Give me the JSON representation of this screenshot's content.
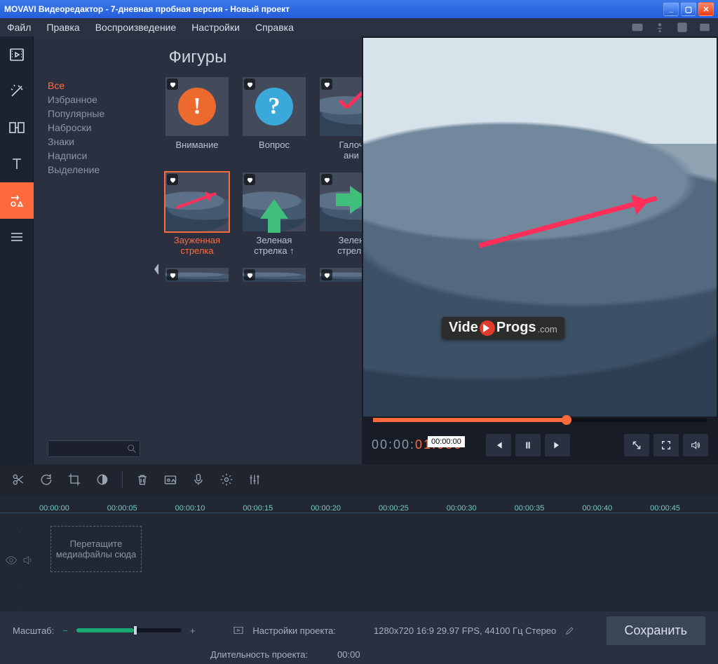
{
  "title": "MOVAVI Видеоредактор - 7-дневная пробная версия - Новый проект",
  "menu": {
    "file": "Файл",
    "edit": "Правка",
    "play": "Воспроизведение",
    "settings": "Настройки",
    "help": "Справка"
  },
  "panel": {
    "title": "Фигуры",
    "filters": [
      "Все",
      "Избранное",
      "Популярные",
      "Наброски",
      "Знаки",
      "Надписи",
      "Выделение"
    ],
    "active_filter": 0,
    "search_placeholder": "",
    "items": [
      {
        "label": "Внимание",
        "kind": "disk-orange-excl",
        "selected": false
      },
      {
        "label": "Вопрос",
        "kind": "disk-blue-q",
        "selected": false
      },
      {
        "label": "Галочка",
        "kind": "check-red",
        "selected": false,
        "clipped": "Галоч\nани"
      },
      {
        "label": "Зауженная стрелка",
        "kind": "arrow-red",
        "selected": true
      },
      {
        "label": "Зеленая стрелка ↑",
        "kind": "arrow-up-green",
        "selected": false
      },
      {
        "label": "Зеленая стрелка →",
        "kind": "arrow-right-green",
        "selected": false,
        "clipped": "Зелен\nстрелк"
      }
    ]
  },
  "player": {
    "timecode_gray": "00:00:",
    "timecode_orange": "01.086",
    "tooltip": "00:00:00",
    "progress_pct": 58
  },
  "timeline": {
    "ruler": [
      "00:00:00",
      "00:00:05",
      "00:00:10",
      "00:00:15",
      "00:00:20",
      "00:00:25",
      "00:00:30",
      "00:00:35",
      "00:00:40",
      "00:00:45"
    ],
    "dropzone": "Перетащите медиафайлы сюда"
  },
  "status": {
    "zoom_label": "Масштаб:",
    "proj_settings_label": "Настройки проекта:",
    "proj_settings_value": "1280x720 16:9 29.97 FPS, 44100 Гц Стерео",
    "duration_label": "Длительность проекта:",
    "duration_value": "00:00",
    "save": "Сохранить"
  },
  "watermark": {
    "a": "Vide",
    "b": "Progs",
    "dom": ".com"
  }
}
